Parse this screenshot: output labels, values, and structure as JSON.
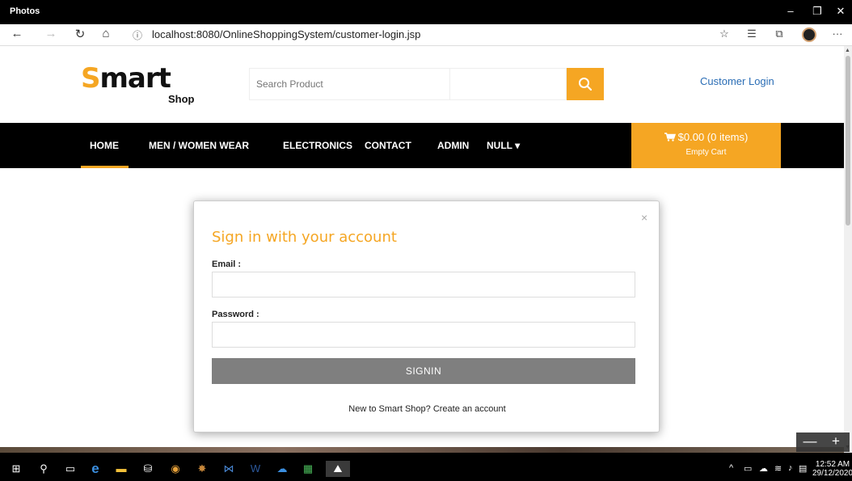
{
  "app": {
    "title": "Photos"
  },
  "window_controls": {
    "minimize": "–",
    "restore": "❐",
    "close": "✕"
  },
  "browser": {
    "url": "localhost:8080/OnlineShoppingSystem/customer-login.jsp",
    "more": "···"
  },
  "header": {
    "logo_s": "S",
    "logo_rest": "mart",
    "logo_sub": "Shop",
    "search_placeholder": "Search Product",
    "login_label": "Customer Login"
  },
  "nav": {
    "items": [
      {
        "label": "HOME"
      },
      {
        "label": "MEN / WOMEN WEAR"
      },
      {
        "label": "ELECTRONICS"
      },
      {
        "label": "CONTACT"
      },
      {
        "label": "ADMIN"
      },
      {
        "label": "NULL ▾"
      }
    ],
    "cart_total": "$0.00 (0 items)",
    "cart_sub": "Empty Cart"
  },
  "modal": {
    "close": "×",
    "title": "Sign in with your account",
    "email_label": "Email :",
    "password_label": "Password :",
    "signin_label": "SIGNIN",
    "create_text": "New to Smart Shop? Create an account"
  },
  "zoom": {
    "minus": "—",
    "plus": "+"
  },
  "taskbar": {
    "time": "12:52 AM",
    "date": "29/12/2020"
  },
  "colors": {
    "accent": "#f5a623",
    "link": "#2a6db5",
    "button": "#7f7f7f"
  }
}
